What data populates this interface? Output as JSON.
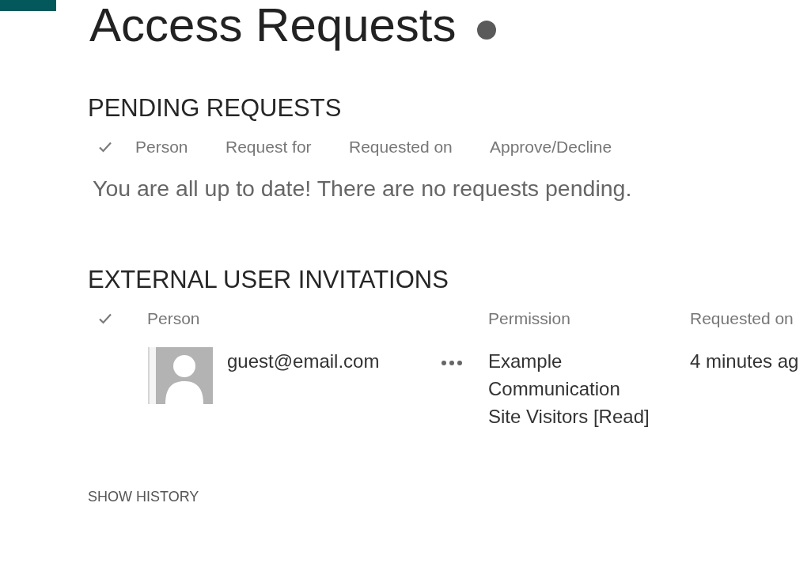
{
  "page": {
    "title": "Access Requests"
  },
  "pending_requests": {
    "heading": "PENDING REQUESTS",
    "columns": [
      "Person",
      "Request for",
      "Requested on",
      "Approve/Decline"
    ],
    "empty_message": "You are all up to date! There are no requests pending."
  },
  "external_user_invitations": {
    "heading": "EXTERNAL USER INVITATIONS",
    "columns": [
      "Person",
      "Permission",
      "Requested on"
    ],
    "rows": [
      {
        "person": "guest@email.com",
        "permission": "Example Communication Site Visitors [Read]",
        "requested_on": "4 minutes ag"
      }
    ]
  },
  "show_history": "SHOW HISTORY"
}
